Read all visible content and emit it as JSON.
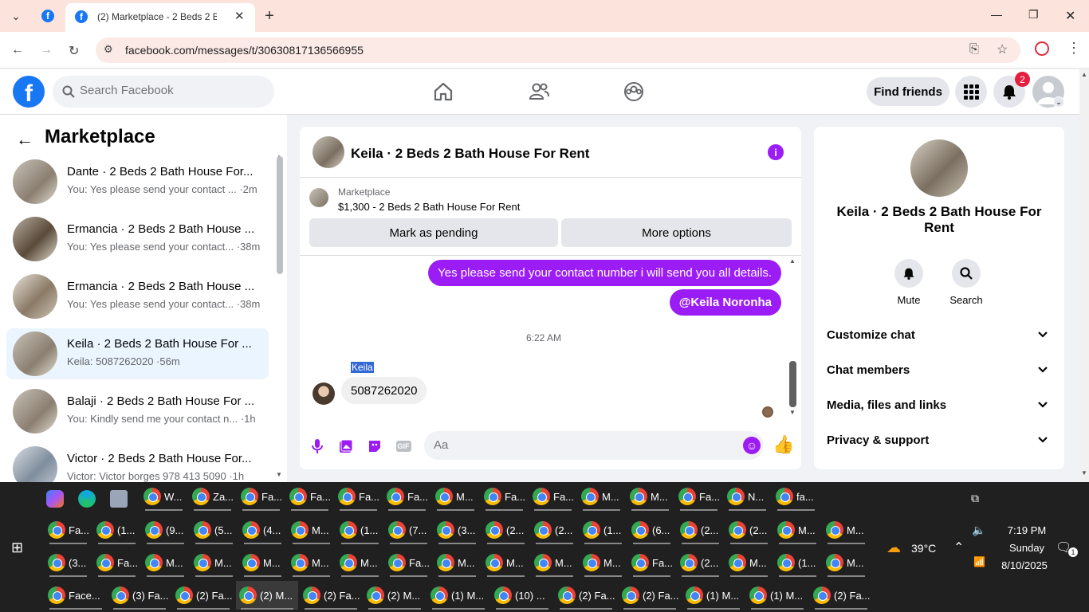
{
  "browser": {
    "tab_title": "(2) Marketplace - 2 Beds 2 Bath",
    "url": "facebook.com/messages/t/30630817136566955"
  },
  "fb_header": {
    "search_placeholder": "Search Facebook",
    "find_friends": "Find friends",
    "notification_count": "2"
  },
  "left_panel": {
    "title": "Marketplace",
    "conversations": [
      {
        "name": "Dante · 2 Beds 2 Bath House For...",
        "preview": "You: Yes please send your contact ... ·2m"
      },
      {
        "name": "Ermancia · 2 Beds 2 Bath House ...",
        "preview": "You: Yes please send your contact... ·38m"
      },
      {
        "name": "Ermancia · 2 Beds 2 Bath House ...",
        "preview": "You: Yes please send your contact... ·38m"
      },
      {
        "name": "Keila · 2 Beds 2 Bath House For ...",
        "preview": "Keila: 5087262020 ·56m"
      },
      {
        "name": "Balaji · 2 Beds 2 Bath House For ...",
        "preview": "You: Kindly send me your contact n... ·1h"
      },
      {
        "name": "Victor · 2 Beds 2 Bath House For...",
        "preview": "Victor: Victor borges 978 413 5090 ·1h"
      }
    ]
  },
  "chat": {
    "title": "Keila · 2 Beds 2 Bath House For Rent",
    "marketplace_label": "Marketplace",
    "listing": "$1,300 - 2 Beds 2 Bath House For Rent",
    "mark_pending": "Mark as pending",
    "more_options": "More options",
    "messages_out": [
      "Yes please send your contact number i will send you all details.",
      "@Keila Noronha"
    ],
    "timestamp": "6:22 AM",
    "sender": "Keila",
    "message_in": "5087262020",
    "composer_placeholder": "Aa",
    "gif_label": "GIF"
  },
  "right_panel": {
    "name": "Keila · 2 Beds 2 Bath House For Rent",
    "mute": "Mute",
    "search": "Search",
    "sections": [
      "Customize chat",
      "Chat members",
      "Media, files and links",
      "Privacy & support"
    ]
  },
  "taskbar": {
    "rows": [
      [
        "W...",
        "Za...",
        "Fa...",
        "Fa...",
        "Fa...",
        "Fa...",
        "M...",
        "Fa...",
        "Fa...",
        "M...",
        "M...",
        "Fa...",
        "N...",
        "fa..."
      ],
      [
        "Fa...",
        "(1...",
        "(9...",
        "(5...",
        "(4...",
        "M...",
        "(1...",
        "(7...",
        "(3...",
        "(2...",
        "(2...",
        "(1...",
        "(6...",
        "(2...",
        "(2...",
        "M...",
        "M..."
      ],
      [
        "(3...",
        "Fa...",
        "M...",
        "M...",
        "M...",
        "M...",
        "M...",
        "Fa...",
        "M...",
        "M...",
        "M...",
        "M...",
        "Fa...",
        "(2...",
        "M...",
        "(1...",
        "M..."
      ],
      [
        "Face...",
        "(3) Fa...",
        "(2) Fa...",
        "(2) M...",
        "(2) Fa...",
        "(2) M...",
        "(1) M...",
        "(10) ...",
        "(2) Fa...",
        "(2) Fa...",
        "(1) M...",
        "(1) M...",
        "(2) Fa..."
      ]
    ],
    "temperature": "39°C",
    "time": "7:19 PM",
    "day": "Sunday",
    "date": "8/10/2025",
    "notif_count": "1"
  }
}
